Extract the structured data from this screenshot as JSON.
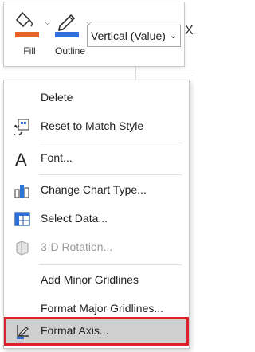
{
  "toolbar": {
    "fill_label": "Fill",
    "outline_label": "Outline",
    "element_select": "Vertical (Value)",
    "fill_color": "#E8632B",
    "outline_color": "#2E6FD8",
    "close_glyph": "X"
  },
  "menu": {
    "items": [
      {
        "label": "Delete",
        "icon": "",
        "enabled": true
      },
      {
        "label": "Reset to Match Style",
        "icon": "reset-style-icon",
        "enabled": true
      },
      {
        "label": "Font...",
        "icon": "font-icon",
        "enabled": true
      },
      {
        "label": "Change Chart Type...",
        "icon": "change-chart-type-icon",
        "enabled": true
      },
      {
        "label": "Select Data...",
        "icon": "select-data-icon",
        "enabled": true
      },
      {
        "label": "3-D Rotation...",
        "icon": "3d-rotation-icon",
        "enabled": false
      },
      {
        "label": "Add Minor Gridlines",
        "icon": "",
        "enabled": true
      },
      {
        "label": "Format Major Gridlines...",
        "icon": "",
        "enabled": true
      },
      {
        "label": "Format Axis...",
        "icon": "format-axis-icon",
        "enabled": true,
        "highlighted": true
      }
    ],
    "highlight_color": "#E0202A"
  }
}
